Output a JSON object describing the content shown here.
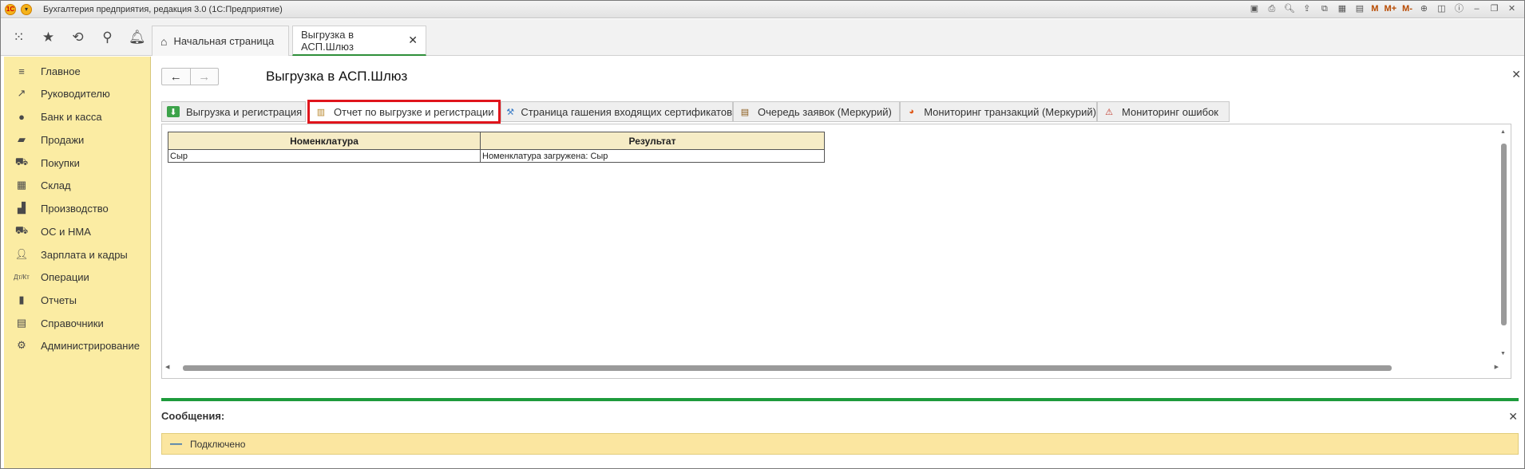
{
  "window": {
    "title": "Бухгалтерия предприятия, редакция 3.0  (1С:Предприятие)",
    "toolbar_m": [
      "M",
      "M+",
      "M-"
    ]
  },
  "top_icons": [
    "apps-grid-icon",
    "star-icon",
    "history-icon",
    "search-icon",
    "bell-icon"
  ],
  "tabs": {
    "home_label": "Начальная страница",
    "active_label": "Выгрузка в АСП.Шлюз"
  },
  "sidebar": {
    "items": [
      {
        "label": "Главное",
        "icon": "menu-lines-icon"
      },
      {
        "label": "Руководителю",
        "icon": "trend-icon"
      },
      {
        "label": "Банк и касса",
        "icon": "coin-icon"
      },
      {
        "label": "Продажи",
        "icon": "bag-icon"
      },
      {
        "label": "Покупки",
        "icon": "cart-icon"
      },
      {
        "label": "Склад",
        "icon": "warehouse-icon"
      },
      {
        "label": "Производство",
        "icon": "factory-icon"
      },
      {
        "label": "ОС и НМА",
        "icon": "truck-icon"
      },
      {
        "label": "Зарплата и кадры",
        "icon": "person-icon"
      },
      {
        "label": "Операции",
        "icon": "dt-kt-icon"
      },
      {
        "label": "Отчеты",
        "icon": "bar-chart-icon"
      },
      {
        "label": "Справочники",
        "icon": "books-icon"
      },
      {
        "label": "Администрирование",
        "icon": "gear-icon"
      }
    ]
  },
  "form": {
    "title": "Выгрузка в АСП.Шлюз",
    "inner_tabs": [
      {
        "label": "Выгрузка и регистрация"
      },
      {
        "label": "Отчет по выгрузке и регистрации"
      },
      {
        "label": "Страница гашения входящих сертификатов"
      },
      {
        "label": "Очередь заявок (Меркурий)"
      },
      {
        "label": "Мониторинг транзакций (Меркурий)"
      },
      {
        "label": "Мониторинг ошибок"
      }
    ],
    "table": {
      "headers": [
        "Номенклатура",
        "Результат"
      ],
      "rows": [
        [
          "Сыр",
          "Номенклатура загружена: Сыр"
        ]
      ]
    }
  },
  "messages": {
    "title": "Сообщения:",
    "items": [
      "Подключено"
    ]
  }
}
